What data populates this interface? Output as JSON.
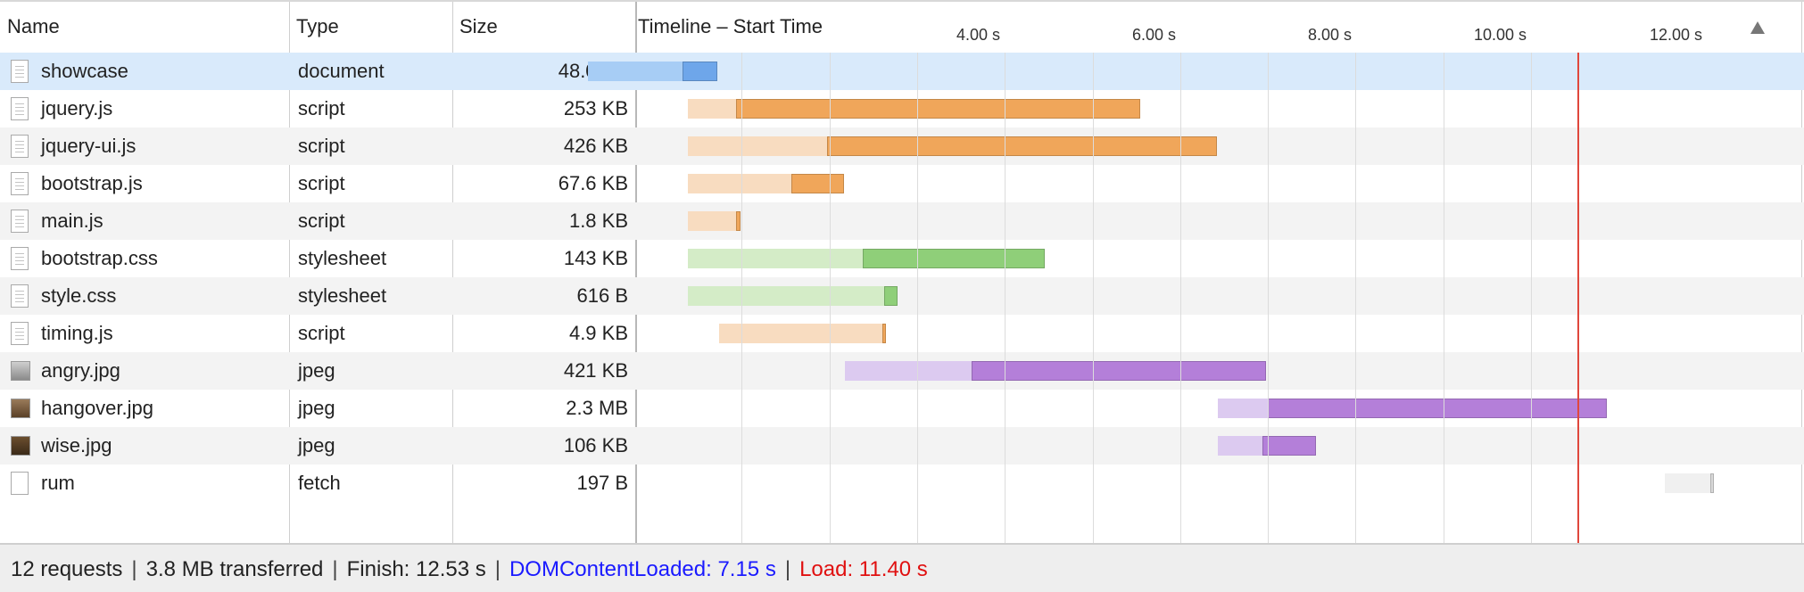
{
  "columns": {
    "name": "Name",
    "type": "Type",
    "size": "Size",
    "timeline": "Timeline – Start Time"
  },
  "timeline_ticks": [
    "4.00 s",
    "6.00 s",
    "8.00 s",
    "10.00 s",
    "12.00 s"
  ],
  "sort_icon": "triangle-up-icon",
  "colors": {
    "document": [
      "#a7cdf5",
      "#6ea6ea"
    ],
    "script": [
      "#f8dcc0",
      "#f0a65a"
    ],
    "stylesheet": [
      "#d4ecc7",
      "#8fcf79"
    ],
    "jpeg": [
      "#dccaf0",
      "#b47fd9"
    ],
    "fetch": [
      "#f0f0f0",
      "#d8d8d8"
    ],
    "load_line": "#e0473c",
    "selection": "#d9eafb"
  },
  "requests": [
    {
      "name": "showcase",
      "type": "document",
      "size": "48.0 KB",
      "icon": "document-icon",
      "start": 1.25,
      "recv": 2.33,
      "end": 2.72,
      "selected": true
    },
    {
      "name": "jquery.js",
      "type": "script",
      "size": "253 KB",
      "icon": "script-file-icon",
      "start": 2.39,
      "recv": 2.94,
      "end": 7.54
    },
    {
      "name": "jquery-ui.js",
      "type": "script",
      "size": "426 KB",
      "icon": "script-file-icon",
      "start": 2.39,
      "recv": 3.97,
      "end": 8.42
    },
    {
      "name": "bootstrap.js",
      "type": "script",
      "size": "67.6 KB",
      "icon": "script-file-icon",
      "start": 2.39,
      "recv": 3.57,
      "end": 4.17
    },
    {
      "name": "main.js",
      "type": "script",
      "size": "1.8 KB",
      "icon": "script-file-icon",
      "start": 2.39,
      "recv": 2.94,
      "end": 2.99
    },
    {
      "name": "bootstrap.css",
      "type": "stylesheet",
      "size": "143 KB",
      "icon": "stylesheet-file-icon",
      "start": 2.39,
      "recv": 4.38,
      "end": 6.46
    },
    {
      "name": "style.css",
      "type": "stylesheet",
      "size": "616 B",
      "icon": "stylesheet-file-icon",
      "start": 2.39,
      "recv": 4.62,
      "end": 4.78
    },
    {
      "name": "timing.js",
      "type": "script",
      "size": "4.9 KB",
      "icon": "script-file-icon",
      "start": 2.74,
      "recv": 4.6,
      "end": 4.65
    },
    {
      "name": "angry.jpg",
      "type": "jpeg",
      "size": "421 KB",
      "icon": "image-thumbnail-icon",
      "start": 4.18,
      "recv": 5.62,
      "end": 8.98
    },
    {
      "name": "hangover.jpg",
      "type": "jpeg",
      "size": "2.3 MB",
      "icon": "image-thumbnail-icon",
      "start": 8.43,
      "recv": 9.0,
      "end": 12.86
    },
    {
      "name": "wise.jpg",
      "type": "jpeg",
      "size": "106 KB",
      "icon": "image-thumbnail-icon",
      "start": 8.43,
      "recv": 8.94,
      "end": 9.55
    },
    {
      "name": "rum",
      "type": "fetch",
      "size": "197 B",
      "icon": "blank-file-icon",
      "start": 13.53,
      "recv": 14.04,
      "end": 14.09
    }
  ],
  "load_time": 11.4,
  "status": {
    "requests": "12 requests",
    "transferred": "3.8 MB transferred",
    "finish": "Finish: 12.53 s",
    "dcl": "DOMContentLoaded: 7.15 s",
    "load": "Load: 11.40 s",
    "separator": "|"
  }
}
